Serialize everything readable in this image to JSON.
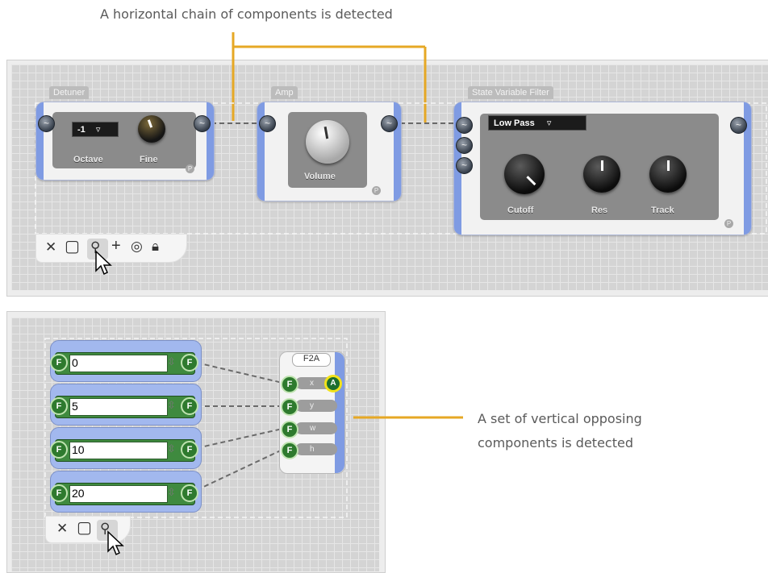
{
  "annotations": {
    "top": "A horizontal chain of components is detected",
    "right_line1": "A set of vertical opposing",
    "right_line2": "components is detected"
  },
  "colors": {
    "accent_orange": "#e6a825",
    "module_blue": "#7f9be3",
    "port_green": "#2e7a2e",
    "output_highlight": "#f2e21a"
  },
  "top_panel": {
    "modules": {
      "detuner": {
        "title": "Detuner",
        "octave_value": "-1",
        "octave_label": "Octave",
        "fine_label": "Fine",
        "badge": "P"
      },
      "amp": {
        "title": "Amp",
        "volume_label": "Volume",
        "badge": "P"
      },
      "svf": {
        "title": "State Variable Filter",
        "mode": "Low Pass",
        "cutoff_label": "Cutoff",
        "res_label": "Res",
        "track_label": "Track",
        "badge": "P"
      }
    },
    "toolbar": [
      "close-icon",
      "square-icon",
      "link-icon",
      "plus-icon",
      "eye-icon",
      "lock-icon"
    ]
  },
  "bottom_panel": {
    "fields": [
      {
        "value": "0",
        "port_label": "F"
      },
      {
        "value": "5",
        "port_label": "F"
      },
      {
        "value": "10",
        "port_label": "F"
      },
      {
        "value": "20",
        "port_label": "F"
      }
    ],
    "f2a": {
      "title": "F2A",
      "inputs": [
        "x",
        "y",
        "w",
        "h"
      ],
      "output_label": "A"
    },
    "toolbar": [
      "close-icon",
      "square-icon",
      "link-icon"
    ]
  }
}
